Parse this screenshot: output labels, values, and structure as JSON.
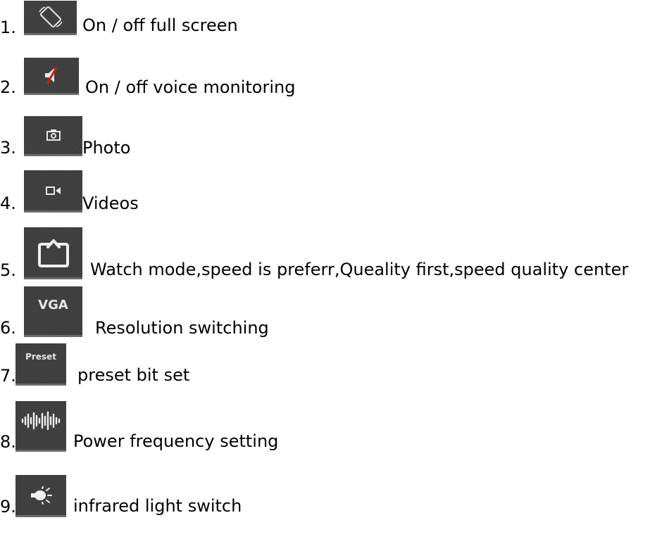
{
  "items": [
    {
      "number": "1.",
      "label": "On / off full screen",
      "icon": "rotate-screen-icon"
    },
    {
      "number": "2.",
      "label": "On / off voice monitoring",
      "icon": "mute-speaker-icon"
    },
    {
      "number": "3.",
      "label": "Photo",
      "icon": "camera-icon"
    },
    {
      "number": "4.",
      "label": "Videos",
      "icon": "video-camera-icon"
    },
    {
      "number": "5.",
      "label": "Watch mode,speed is preferr,Queality first,speed quality center",
      "icon": "watch-mode-icon"
    },
    {
      "number": "6.",
      "label": "Resolution switching",
      "icon": "resolution-icon",
      "icon_text": "VGA"
    },
    {
      "number": "7.",
      "label": "preset  bit  set",
      "icon": "preset-icon",
      "icon_text": "Preset"
    },
    {
      "number": "8.",
      "label": "Power  frequency  setting",
      "icon": "waveform-icon"
    },
    {
      "number": "9.",
      "label": "infrared  light  switch",
      "icon": "infrared-light-icon"
    }
  ]
}
